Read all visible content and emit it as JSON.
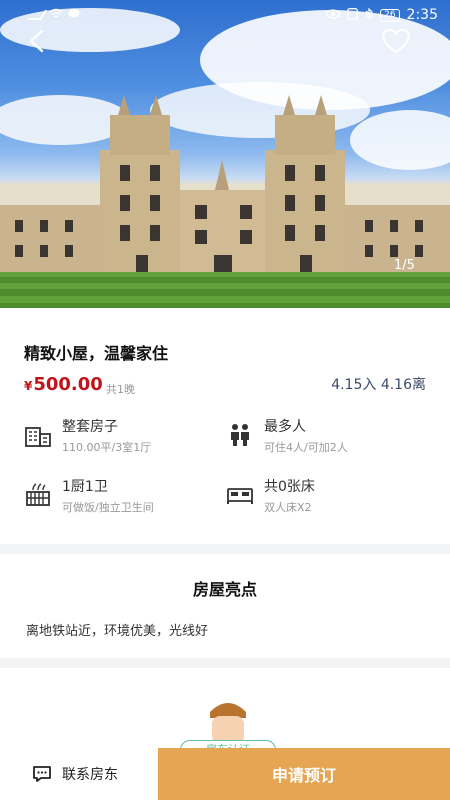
{
  "status_bar": {
    "time": "2:35",
    "battery": "26"
  },
  "gallery": {
    "counter": "1/5"
  },
  "listing": {
    "title": "精致小屋，温馨家住",
    "currency": "¥",
    "price": "500.00",
    "nights": "共1晚",
    "dates": "4.15入 4.16离"
  },
  "features": [
    {
      "icon": "building-icon",
      "title": "整套房子",
      "sub": "110.00平/3室1厅"
    },
    {
      "icon": "people-icon",
      "title": "最多人",
      "sub": "可住4人/可加2人"
    },
    {
      "icon": "kitchen-icon",
      "title": "1厨1卫",
      "sub": "可做饭/独立卫生间"
    },
    {
      "icon": "bed-icon",
      "title": "共0张床",
      "sub": "双人床X2"
    }
  ],
  "highlights": {
    "title": "房屋亮点",
    "text": "离地铁站近，环境优美，光线好"
  },
  "host": {
    "tag": "房东认证"
  },
  "bottom_bar": {
    "contact_label": "联系房东",
    "book_label": "申请预订"
  },
  "colors": {
    "price": "#c0141a",
    "book_button": "#e5a552",
    "dates": "#3b4b6b",
    "tag": "#5fbf9a"
  }
}
